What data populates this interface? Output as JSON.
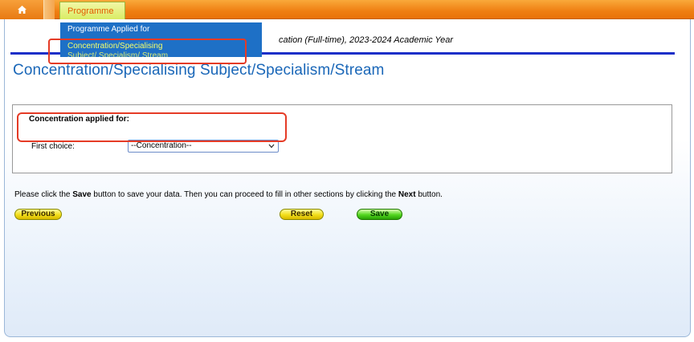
{
  "topbar": {
    "home_icon": "home-icon",
    "programme_tab": "Programme"
  },
  "dropdown": {
    "items": [
      {
        "label": "Programme Applied for"
      },
      {
        "label": "Concentration/Specialising"
      },
      {
        "label": "Subject/ Specialism/ Stream"
      }
    ]
  },
  "page": {
    "subtitle": "cation (Full-time), 2023-2024 Academic Year",
    "title": "Concentration/Specialising Subject/Specialism/Stream"
  },
  "concentration": {
    "heading": "Concentration applied for:",
    "first_choice_label": "First choice:",
    "select_value": "--Concentration--"
  },
  "instructions": {
    "part1": "Please click the ",
    "save_word": "Save",
    "part2": " button to save your data. Then you can proceed to fill in other sections by clicking the ",
    "next_word": "Next",
    "part3": " button."
  },
  "buttons": {
    "previous": "Previous",
    "reset": "Reset",
    "save": "Save"
  },
  "colors": {
    "topbar": "#ef7f12",
    "title_blue": "#1a67b8",
    "rule_blue": "#1c2fc8",
    "menu_blue": "#1e70c6",
    "highlight_red": "#e53b26"
  }
}
